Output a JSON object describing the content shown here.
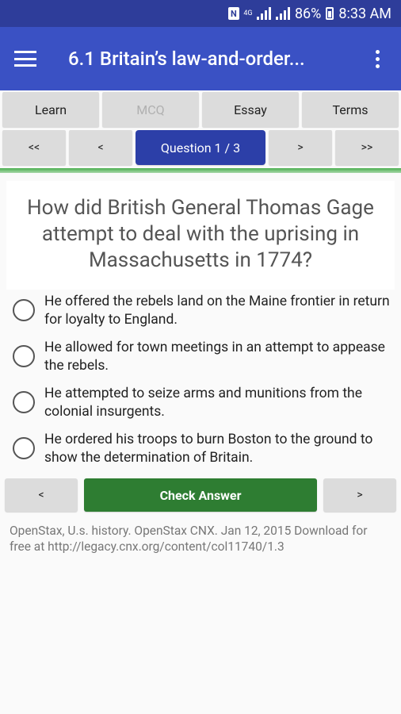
{
  "status_bar": {
    "battery": "86%",
    "time": "8:33 AM",
    "network": "4G"
  },
  "app_bar": {
    "title": "6.1 Britain’s law-and-order..."
  },
  "tabs": [
    {
      "label": "Learn",
      "enabled": true
    },
    {
      "label": "MCQ",
      "enabled": false
    },
    {
      "label": "Essay",
      "enabled": true
    },
    {
      "label": "Terms",
      "enabled": true
    }
  ],
  "nav": {
    "first": "<<",
    "prev": "<",
    "question": "Question 1 / 3",
    "next": ">",
    "last": ">>"
  },
  "question": {
    "text": "How did British General Thomas Gage attempt to deal with the uprising in Massachusetts in 1774?"
  },
  "options": [
    {
      "text": "He offered the rebels land on the Maine frontier in return for loyalty to England."
    },
    {
      "text": "He allowed for town meetings in an attempt to appease the rebels."
    },
    {
      "text": "He attempted to seize arms and munitions from the colonial insurgents."
    },
    {
      "text": "He ordered his troops to burn Boston to the ground to show the determination of Britain."
    }
  ],
  "actions": {
    "prev": "<",
    "check": "Check Answer",
    "next": ">"
  },
  "citation": "OpenStax, U.s. history. OpenStax CNX. Jan 12, 2015 Download for free at http://legacy.cnx.org/content/col11740/1.3",
  "colors": {
    "status_bar": "#2e3d9a",
    "app_bar": "#3a51c4",
    "question_button": "#2c3fa8",
    "check_button": "#2e7d32",
    "progress": "#4caf50"
  }
}
